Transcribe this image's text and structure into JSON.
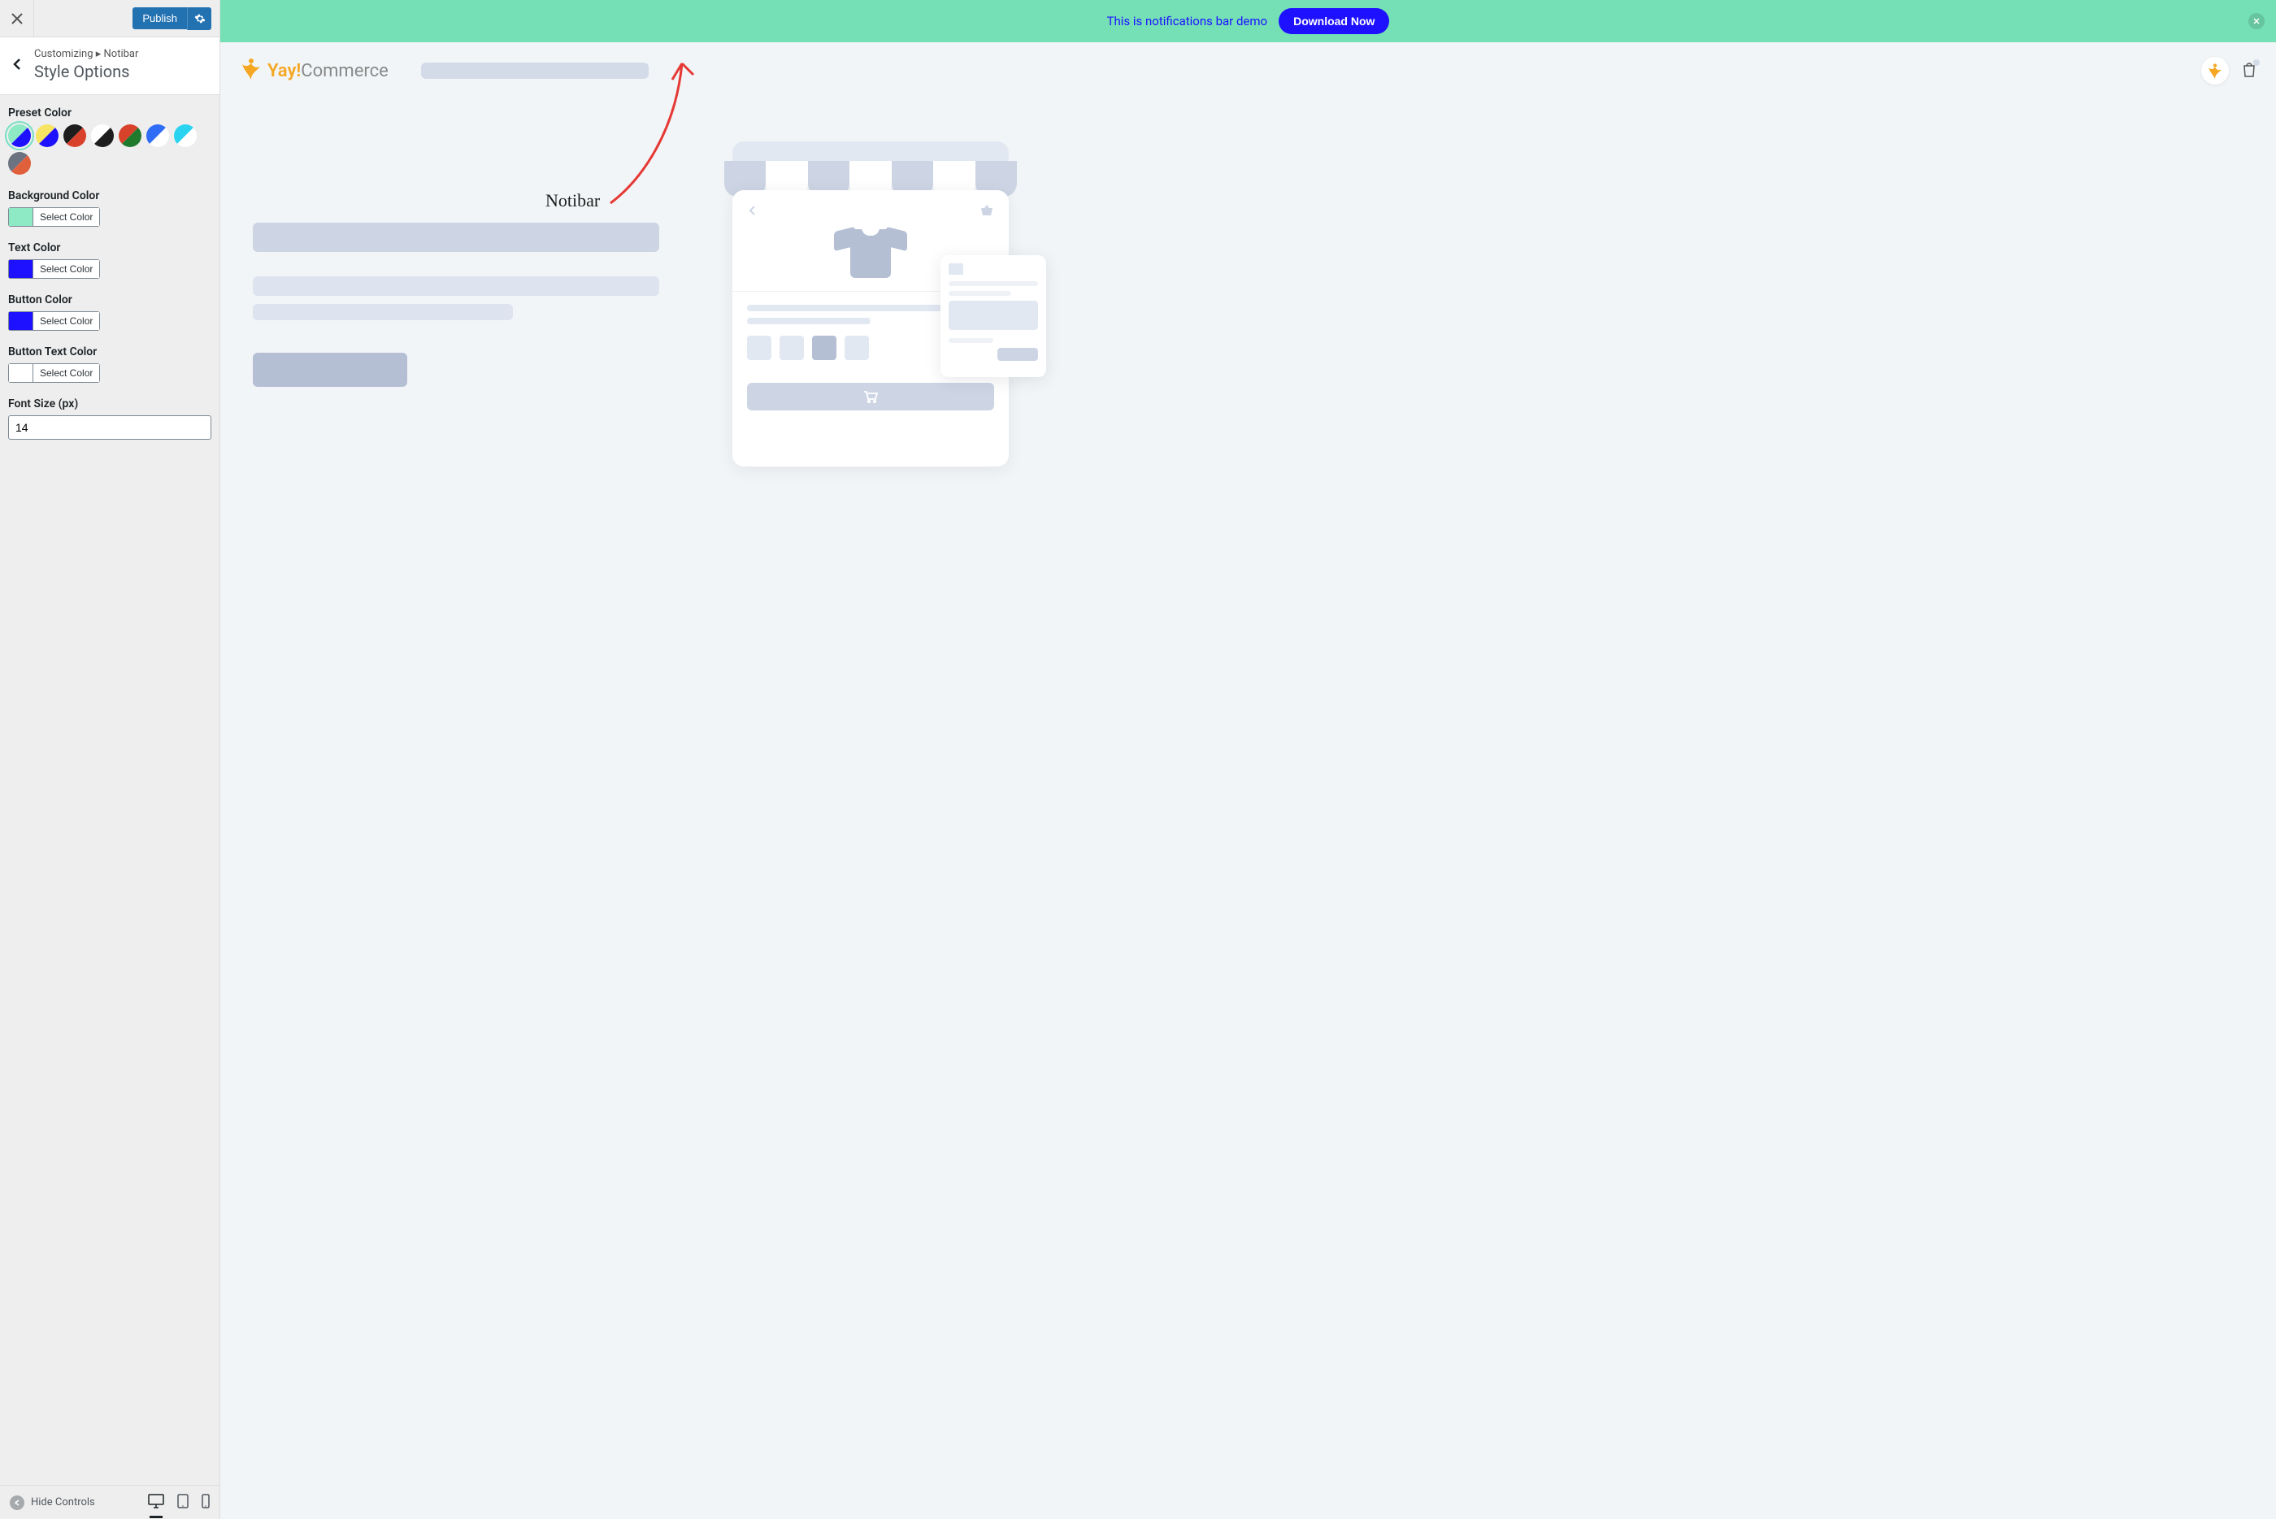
{
  "sidebar": {
    "publish_label": "Publish",
    "breadcrumb_prefix": "Customizing ▸ Notibar",
    "title": "Style Options",
    "preset_color_label": "Preset Color",
    "background_color_label": "Background Color",
    "text_color_label": "Text Color",
    "button_color_label": "Button Color",
    "button_text_color_label": "Button Text Color",
    "font_size_label": "Font Size (px)",
    "font_size_value": "14",
    "select_color": "Select Color",
    "hide_controls": "Hide Controls",
    "colors": {
      "background": "#8ee9c5",
      "text": "#1d11ff",
      "button": "#1d11ff",
      "button_text": "#ffffff"
    },
    "presets": [
      {
        "c1": "#8ee9c5",
        "c2": "#1d11ff",
        "active": true
      },
      {
        "c1": "#f7e463",
        "c2": "#1d11ff"
      },
      {
        "c1": "#1d1d1d",
        "c2": "#d9422a"
      },
      {
        "c1": "#ffffff",
        "c2": "#1d1d1d"
      },
      {
        "c1": "#d9422a",
        "c2": "#1f7a2e"
      },
      {
        "c1": "#2f6df6",
        "c2": "#ffffff"
      },
      {
        "c1": "#2ad4f0",
        "c2": "#ffffff"
      },
      {
        "c1": "#6b7280",
        "c2": "#e0603c"
      }
    ]
  },
  "notibar": {
    "text": "This is notifications bar demo",
    "button": "Download Now"
  },
  "preview": {
    "logo_yay": "Yay!",
    "logo_commerce": "Commerce"
  },
  "annotation": {
    "label": "Notibar"
  }
}
